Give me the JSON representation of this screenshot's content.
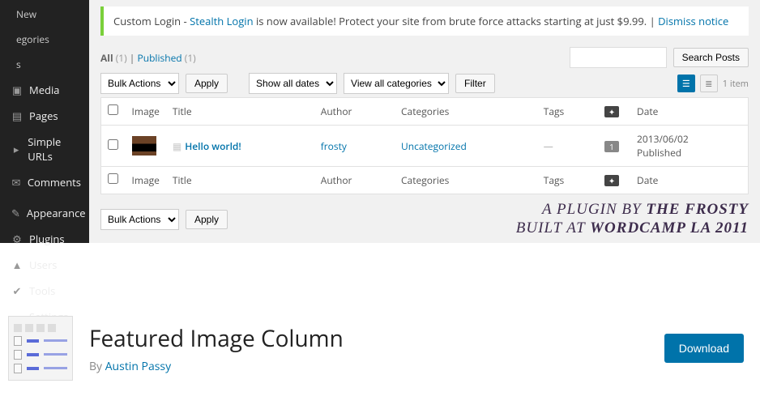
{
  "sidebar": {
    "items": [
      {
        "label": "New",
        "icon": ""
      },
      {
        "label": "egories",
        "icon": ""
      },
      {
        "label": "s",
        "icon": ""
      },
      {
        "label": "Media",
        "icon": "▣"
      },
      {
        "label": "Pages",
        "icon": "▤"
      },
      {
        "label": "Simple URLs",
        "icon": "▸"
      },
      {
        "label": "Comments",
        "icon": "✉"
      },
      {
        "label": "Appearance",
        "icon": "✎"
      },
      {
        "label": "Plugins",
        "icon": "⚙"
      },
      {
        "label": "Users",
        "icon": "▲"
      },
      {
        "label": "Tools",
        "icon": "✔"
      },
      {
        "label": "Settings",
        "icon": "⚏"
      }
    ]
  },
  "notice": {
    "prefix": "Custom Login - ",
    "product": "Stealth Login",
    "msg": " is now available! Protect your site from brute force attacks starting at just $9.99. | ",
    "dismiss": "Dismiss notice"
  },
  "subsub": {
    "all": "All",
    "all_count": "(1)",
    "sep": " | ",
    "pub": "Published",
    "pub_count": "(1)"
  },
  "search": {
    "placeholder": "",
    "button": "Search Posts"
  },
  "bulk": {
    "label": "Bulk Actions",
    "apply": "Apply"
  },
  "filters": {
    "dates": "Show all dates",
    "cats": "View all categories",
    "filter": "Filter",
    "item_count": "1 item"
  },
  "cols": {
    "image": "Image",
    "title": "Title",
    "author": "Author",
    "categories": "Categories",
    "tags": "Tags",
    "date": "Date"
  },
  "rows": [
    {
      "title": "Hello world!",
      "author": "frosty",
      "category": "Uncategorized",
      "tags": "—",
      "comments": "1",
      "date": "2013/06/02",
      "status": "Published"
    }
  ],
  "credit": {
    "line1_a": "A PLUGIN BY ",
    "line1_b": "THE FROSTY",
    "line2_a": "BUILT AT ",
    "line2_b": "WORDCAMP LA 2011"
  },
  "plugin": {
    "title": "Featured Image Column",
    "by_prefix": "By ",
    "author": "Austin Passy",
    "download": "Download"
  }
}
